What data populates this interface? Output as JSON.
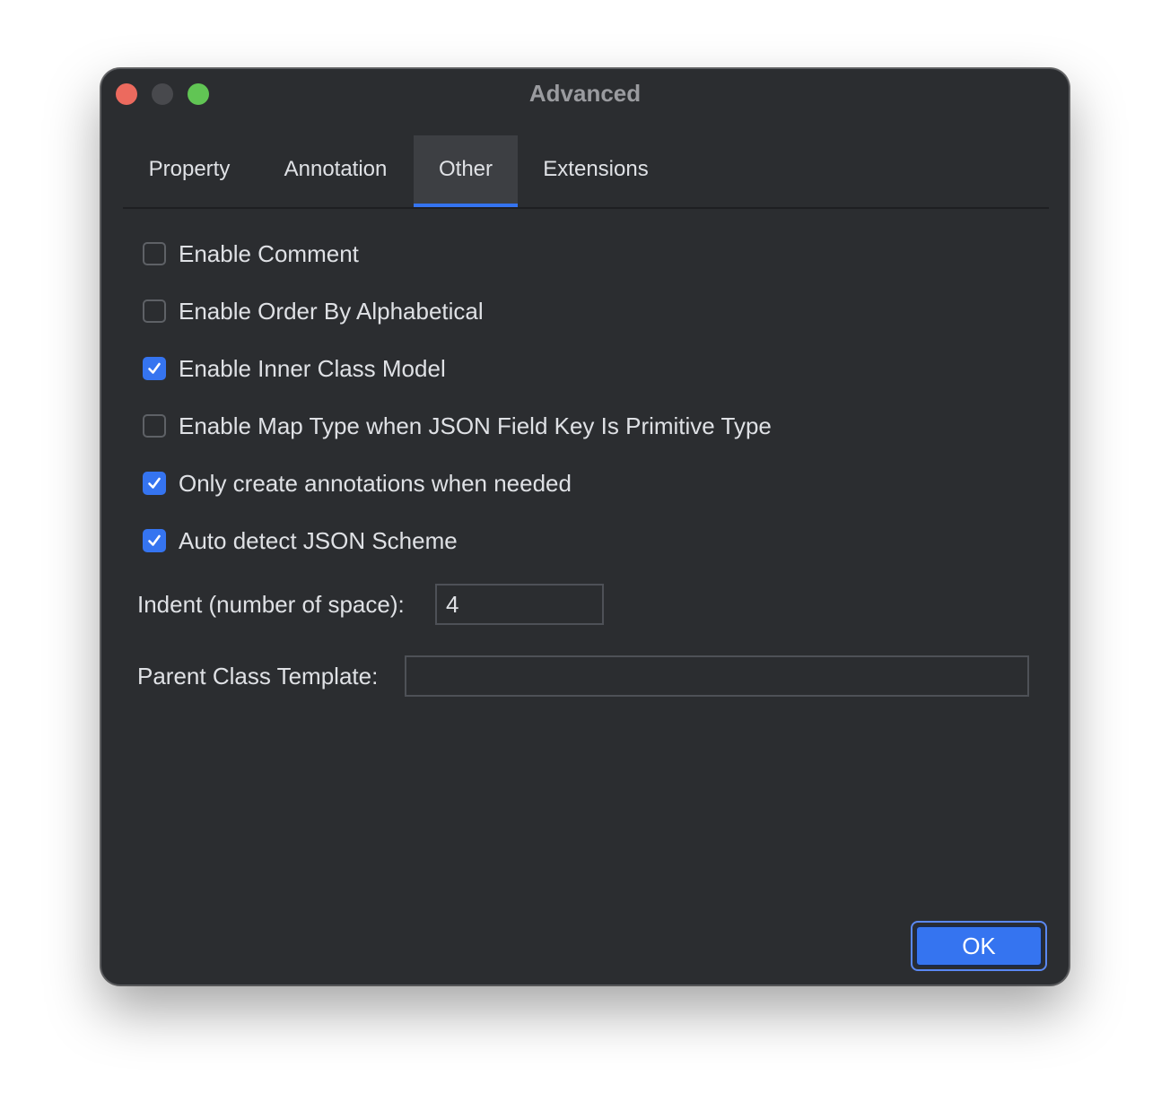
{
  "window": {
    "title": "Advanced"
  },
  "tabs": [
    {
      "label": "Property",
      "active": false
    },
    {
      "label": "Annotation",
      "active": false
    },
    {
      "label": "Other",
      "active": true
    },
    {
      "label": "Extensions",
      "active": false
    }
  ],
  "options": [
    {
      "label": "Enable Comment",
      "checked": false
    },
    {
      "label": "Enable Order By Alphabetical",
      "checked": false
    },
    {
      "label": "Enable Inner Class Model",
      "checked": true
    },
    {
      "label": "Enable Map Type when JSON Field Key Is Primitive Type",
      "checked": false
    },
    {
      "label": "Only create annotations when needed",
      "checked": true
    },
    {
      "label": "Auto detect JSON Scheme",
      "checked": true
    }
  ],
  "indent": {
    "label": "Indent (number of space):",
    "value": "4"
  },
  "parent_class_template": {
    "label": "Parent Class Template:",
    "value": ""
  },
  "ok_button": {
    "label": "OK"
  },
  "colors": {
    "background": "#2b2d30",
    "accent": "#3574f0",
    "text": "#dfe1e5",
    "traffic_close": "#ec6a5e",
    "traffic_minimize": "#48494d",
    "traffic_maximize": "#61c554"
  },
  "icons": {
    "checkmark": "checkmark-icon"
  }
}
